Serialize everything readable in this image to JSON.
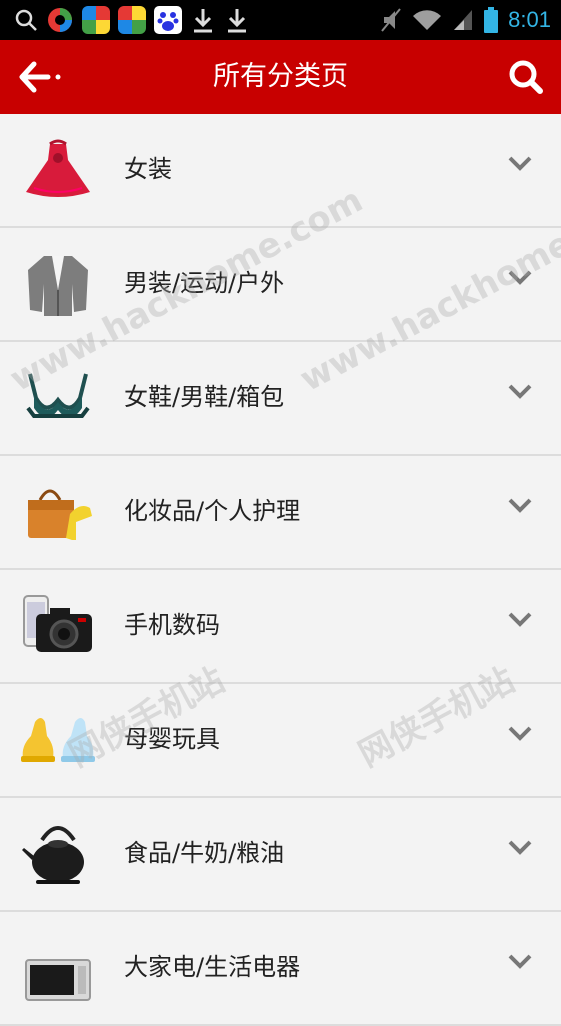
{
  "status_bar": {
    "time": "8:01",
    "left_icons": [
      "search-icon",
      "app-icon-1",
      "app-icon-2",
      "app-icon-3",
      "baidu-icon",
      "download-icon",
      "download-icon"
    ],
    "right_icons": [
      "mute-icon",
      "wifi-icon",
      "signal-icon",
      "battery-icon"
    ]
  },
  "header": {
    "title": "所有分类页",
    "bg_color": "#c80000"
  },
  "categories": [
    {
      "label": "女装",
      "icon": "dress-icon"
    },
    {
      "label": "男装/运动/户外",
      "icon": "jacket-icon"
    },
    {
      "label": "女鞋/男鞋/箱包",
      "icon": "lingerie-icon"
    },
    {
      "label": "化妆品/个人护理",
      "icon": "handbag-heels-icon"
    },
    {
      "label": "手机数码",
      "icon": "phone-camera-icon"
    },
    {
      "label": "母婴玩具",
      "icon": "baby-bottle-icon"
    },
    {
      "label": "食品/牛奶/粮油",
      "icon": "teapot-icon"
    },
    {
      "label": "大家电/生活电器",
      "icon": "microwave-icon"
    }
  ],
  "watermarks": [
    "www.hackhome.com",
    "www.hackhome.com",
    "网侠手机站",
    "网侠手机站"
  ]
}
